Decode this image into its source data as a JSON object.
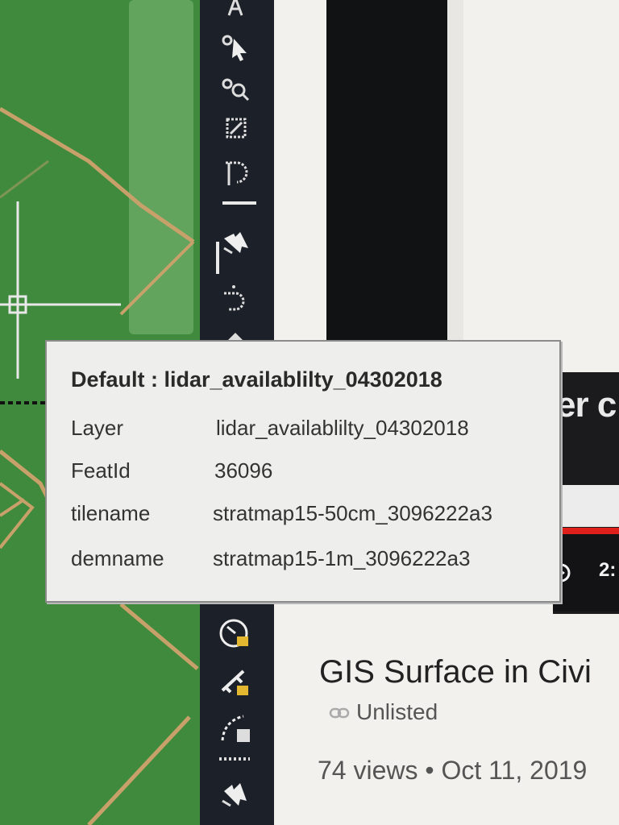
{
  "tooltip": {
    "title": "Default : lidar_availablilty_04302018",
    "rows": [
      {
        "key": "Layer",
        "value": "lidar_availablilty_04302018"
      },
      {
        "key": "FeatId",
        "value": "36096"
      },
      {
        "key": "tilename",
        "value": "stratmap15-50cm_3096222a3"
      },
      {
        "key": "demname",
        "value": "stratmap15-1m_3096222a3"
      }
    ]
  },
  "video": {
    "thumb_text": "er c",
    "time_fragment": "2:",
    "title": "GIS Surface in Civi",
    "visibility": "Unlisted",
    "meta": "74 views • Oct 11, 2019"
  },
  "colors": {
    "map_green": "#3f8a3c",
    "parcel_line": "#c8a06a",
    "toolbar_bg": "#1c2028",
    "tooltip_bg": "#eeeeec",
    "progress_red": "#e0201d"
  },
  "icons": {
    "map_crosshair": "crosshair-icon",
    "toolbar": [
      "text-icon",
      "select-pointer-icon",
      "zoom-select-icon",
      "frame-icon",
      "arc-icon",
      "multi-select-icon",
      "dashed-arc-icon",
      "globe-icon",
      "gauge-icon",
      "measure-icon",
      "curve-calc-icon",
      "pointer-select-icon"
    ]
  }
}
